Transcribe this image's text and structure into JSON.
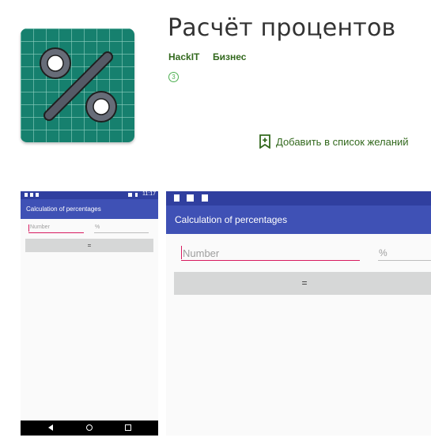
{
  "app": {
    "title": "Расчёт процентов",
    "developer": "HackIT",
    "category": "Бизнес",
    "content_rating": "3",
    "wishlist_label": "Добавить в список желаний",
    "icon": "percent-icon",
    "colors": {
      "accent": "#33691e",
      "icon_bg": "#16806e"
    }
  },
  "screenshots": [
    {
      "status_time": "11:17",
      "appbar_title": "Calculation of percentages",
      "number_placeholder": "Number",
      "percent_placeholder": "%",
      "button_label": "=",
      "colors": {
        "primary": "#3f51b5",
        "primary_dark": "#303f9f",
        "accent": "#d81b60"
      }
    },
    {
      "appbar_title": "Calculation of percentages",
      "number_placeholder": "Number",
      "percent_placeholder": "%",
      "button_label": "="
    }
  ]
}
